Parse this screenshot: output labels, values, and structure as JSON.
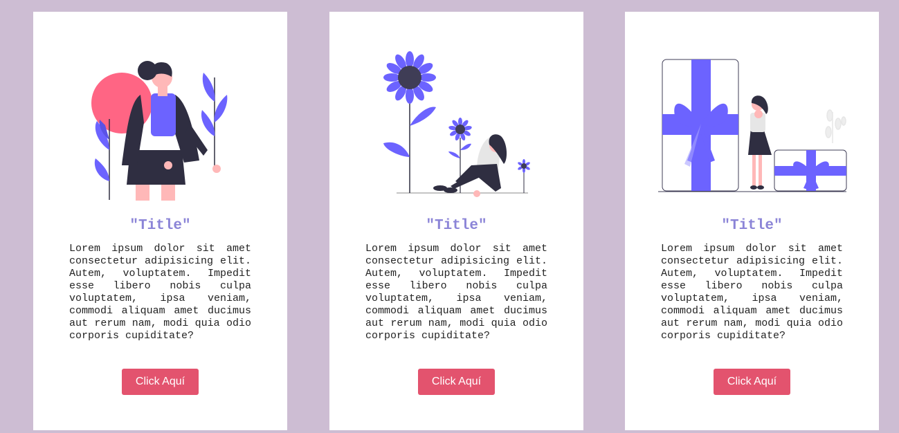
{
  "colors": {
    "background": "#cdbdd3",
    "card": "#ffffff",
    "title": "#8b84d7",
    "button": "#e3536e",
    "accent": "#6c63ff",
    "dark": "#2f2e41",
    "skin": "#ffb8b8",
    "sun": "#ff6584"
  },
  "cards": [
    {
      "illustration": "woman-standing-with-plants-illustration",
      "title": "\"Title\"",
      "text": "Lorem ipsum dolor sit amet consectetur adipisicing elit. Autem, voluptatem. Impedit esse libero nobis culpa voluptatem, ipsa veniam, commodi aliquam amet ducimus aut rerum nam, modi quia odio corporis cupiditate?",
      "button_label": "Click Aquí"
    },
    {
      "illustration": "woman-sitting-with-sunflowers-illustration",
      "title": "\"Title\"",
      "text": "Lorem ipsum dolor sit amet consectetur adipisicing elit. Autem, voluptatem. Impedit esse libero nobis culpa voluptatem, ipsa veniam, commodi aliquam amet ducimus aut rerum nam, modi quia odio corporis cupiditate?",
      "button_label": "Click Aquí"
    },
    {
      "illustration": "woman-with-gift-boxes-illustration",
      "title": "\"Title\"",
      "text": "Lorem ipsum dolor sit amet consectetur adipisicing elit. Autem, voluptatem. Impedit esse libero nobis culpa voluptatem, ipsa veniam, commodi aliquam amet ducimus aut rerum nam, modi quia odio corporis cupiditate?",
      "button_label": "Click Aquí"
    }
  ]
}
